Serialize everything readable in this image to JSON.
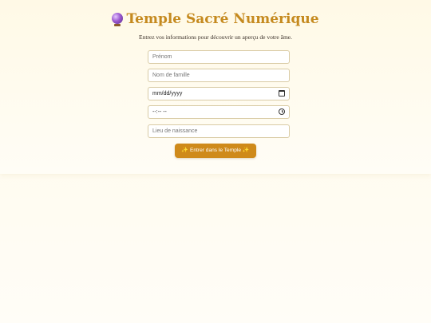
{
  "header": {
    "title_icon": "crystal-ball-icon",
    "title": "Temple Sacré Numérique",
    "subtitle": "Entrez vos informations pour découvrir un aperçu de votre âme."
  },
  "form": {
    "first_name": {
      "placeholder": "Prénom",
      "value": ""
    },
    "last_name": {
      "placeholder": "Nom de famille",
      "value": ""
    },
    "birth_date": {
      "display": "mm/dd/yyyy",
      "icon": "calendar-icon"
    },
    "birth_time": {
      "display": "--:-- --",
      "icon": "clock-icon"
    },
    "birth_place": {
      "placeholder": "Lieu de naissance",
      "value": ""
    }
  },
  "submit": {
    "label": "Entrer dans le Temple",
    "sparkle": "✨"
  },
  "colors": {
    "accent": "#cf8a1a",
    "title": "#c58a1f",
    "background": "#fff8e4"
  }
}
